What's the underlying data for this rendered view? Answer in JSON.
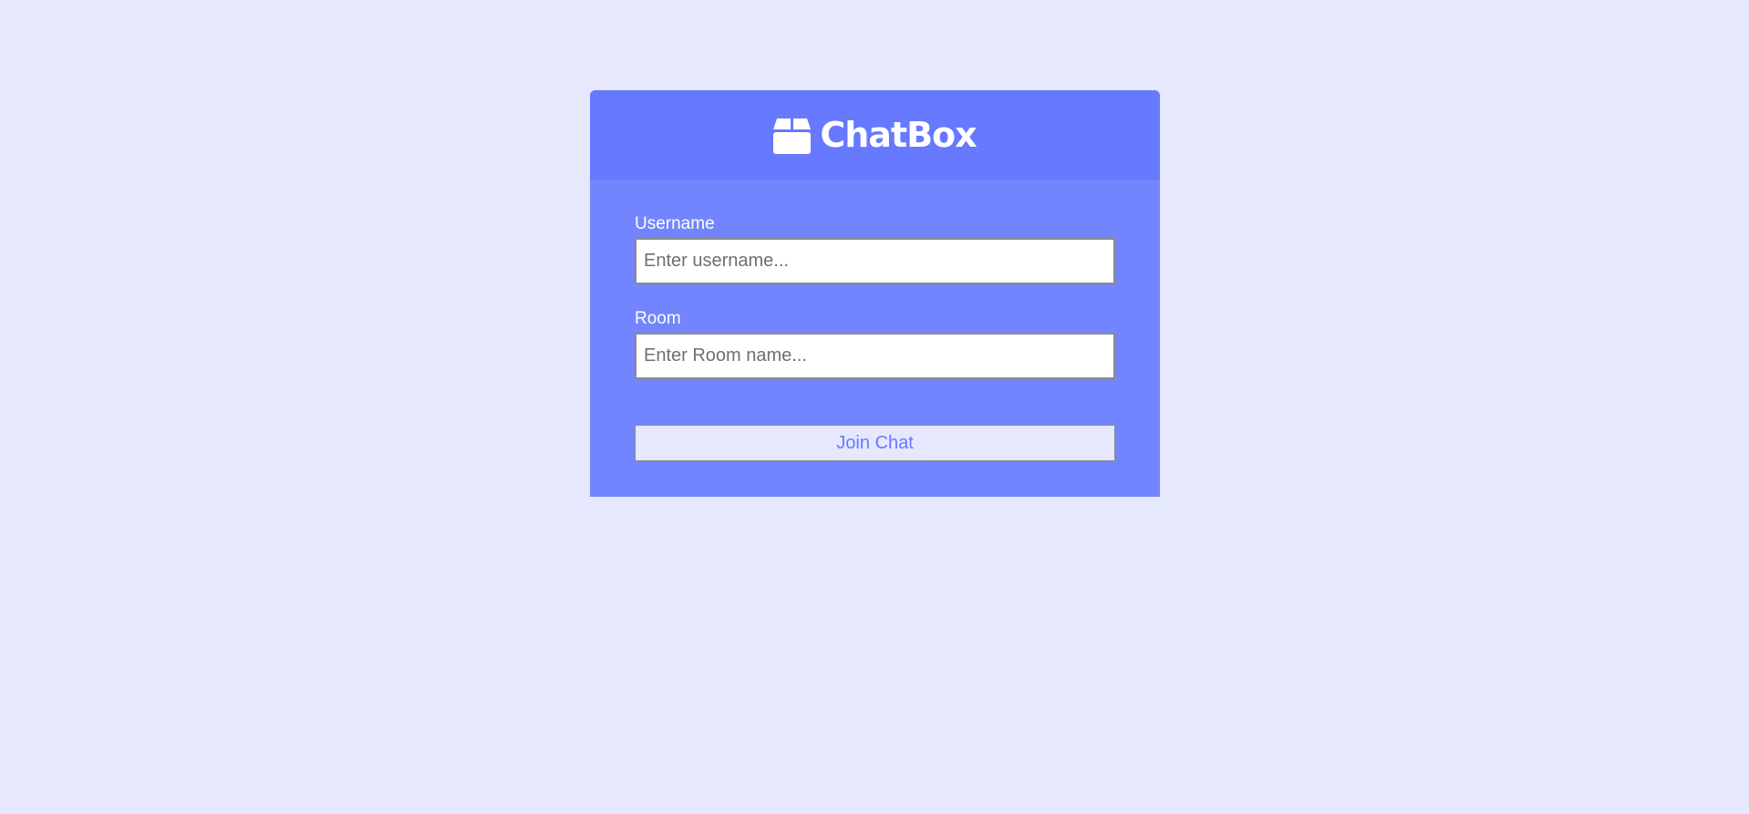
{
  "app": {
    "title": "ChatBox",
    "logo_icon": "box-icon"
  },
  "form": {
    "username_label": "Username",
    "username_placeholder": "Enter username...",
    "username_value": "",
    "room_label": "Room",
    "room_placeholder": "Enter Room name...",
    "room_value": "",
    "submit_label": "Join Chat"
  },
  "colors": {
    "page_background": "#e6e8fe",
    "header_background": "#6779fe",
    "panel_background": "#7385fe",
    "button_text": "#6779fe"
  }
}
